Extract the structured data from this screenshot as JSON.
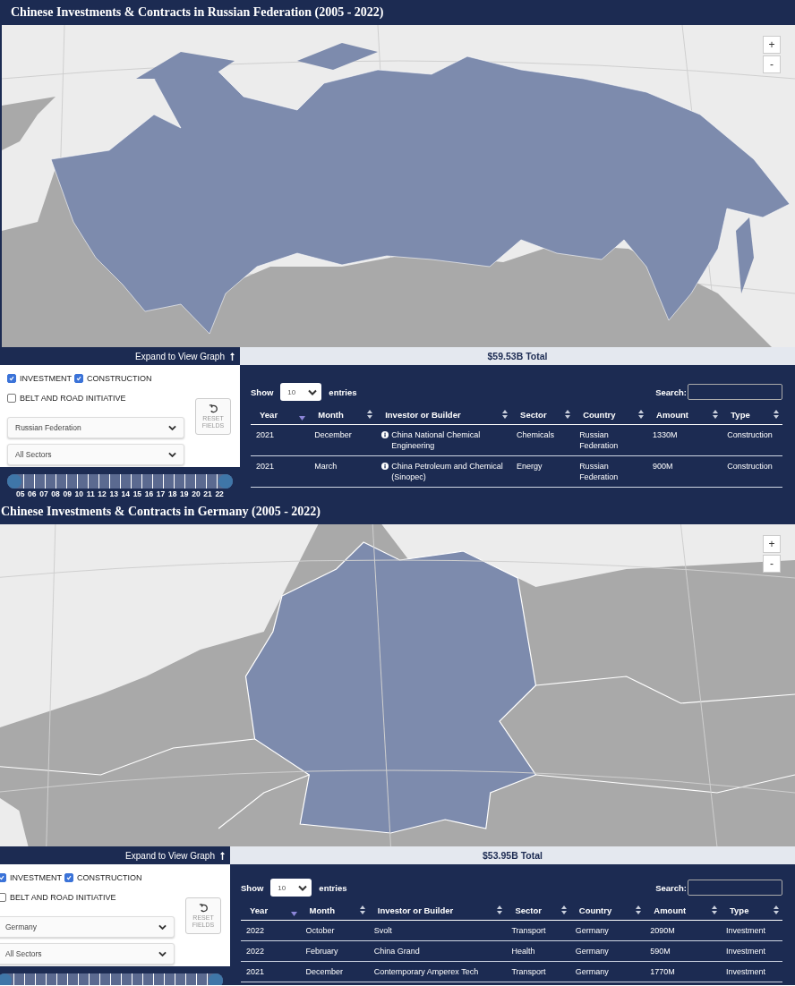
{
  "panels": [
    {
      "title": "Chinese Investments & Contracts in Russian Federation (2005 - 2022)",
      "map": {
        "kind": "russia"
      },
      "zoom_controls": [
        "+",
        "-"
      ],
      "expand_link": "Expand to View Graph",
      "total": "$59.53B Total",
      "checkboxes": [
        {
          "label": "INVESTMENT",
          "checked": true
        },
        {
          "label": "CONSTRUCTION",
          "checked": true
        },
        {
          "label": "BELT AND ROAD INITIATIVE",
          "checked": false
        }
      ],
      "country_select": "Russian Federation",
      "sector_select": "All Sectors",
      "reset_button": "RESET FIELDS",
      "timeline": {
        "level": 1,
        "tick_labels": [
          "05",
          "06",
          "07",
          "08",
          "09",
          "10",
          "11",
          "12",
          "13",
          "14",
          "15",
          "16",
          "17",
          "18",
          "19",
          "20",
          "21",
          "22"
        ]
      },
      "table": {
        "show_label": "Show",
        "page_size": "10",
        "entries_label": "entries",
        "search_label": "Search:",
        "columns": [
          {
            "label": "Year",
            "sorted": true
          },
          {
            "label": "Month",
            "sorted": false
          },
          {
            "label": "Investor or Builder",
            "sorted": false
          },
          {
            "label": "Sector",
            "sorted": false
          },
          {
            "label": "Country",
            "sorted": false
          },
          {
            "label": "Amount",
            "sorted": false
          },
          {
            "label": "Type",
            "sorted": false
          }
        ],
        "rows": [
          {
            "info": true,
            "cells": [
              "2021",
              "December",
              "China National Chemical Engineering",
              "Chemicals",
              "Russian Federation",
              "1330M",
              "Construction"
            ]
          },
          {
            "info": true,
            "cells": [
              "2021",
              "March",
              "China Petroleum and Chemical (Sinopec)",
              "Energy",
              "Russian Federation",
              "900M",
              "Construction"
            ]
          }
        ]
      }
    },
    {
      "title": "Chinese Investments & Contracts in Germany (2005 - 2022)",
      "map": {
        "kind": "germany"
      },
      "zoom_controls": [
        "+",
        "-"
      ],
      "expand_link": "Expand to View Graph",
      "total": "$53.95B Total",
      "checkboxes": [
        {
          "label": "INVESTMENT",
          "checked": true
        },
        {
          "label": "CONSTRUCTION",
          "checked": true
        },
        {
          "label": "BELT AND ROAD INITIATIVE",
          "checked": false
        }
      ],
      "country_select": "Germany",
      "sector_select": "All Sectors",
      "reset_button": "RESET FIELDS",
      "timeline": {
        "level": 1
      },
      "table": {
        "show_label": "Show",
        "page_size": "10",
        "entries_label": "entries",
        "search_label": "Search:",
        "columns": [
          {
            "label": "Year",
            "sorted": true
          },
          {
            "label": "Month",
            "sorted": false
          },
          {
            "label": "Investor or Builder",
            "sorted": false
          },
          {
            "label": "Sector",
            "sorted": false
          },
          {
            "label": "Country",
            "sorted": false
          },
          {
            "label": "Amount",
            "sorted": false
          },
          {
            "label": "Type",
            "sorted": false
          }
        ],
        "rows": [
          {
            "info": false,
            "cells": [
              "2022",
              "October",
              "Svolt",
              "Transport",
              "Germany",
              "2090M",
              "Investment"
            ]
          },
          {
            "info": false,
            "cells": [
              "2022",
              "February",
              "China Grand",
              "Health",
              "Germany",
              "590M",
              "Investment"
            ]
          },
          {
            "info": false,
            "cells": [
              "2021",
              "December",
              "Contemporary Amperex Tech",
              "Transport",
              "Germany",
              "1770M",
              "Investment"
            ]
          }
        ]
      }
    }
  ]
}
